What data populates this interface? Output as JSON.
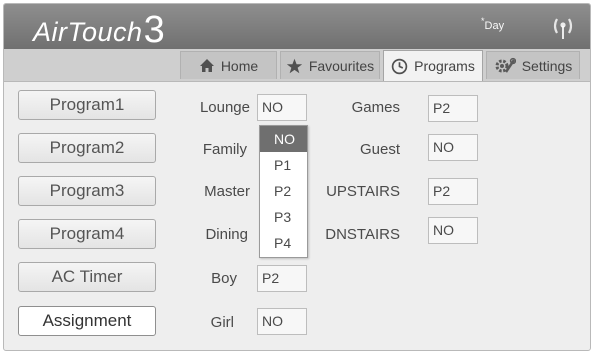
{
  "app": {
    "logo_text": "AirTouch",
    "logo_number": "3",
    "mode_star": "*",
    "mode_text": "Day"
  },
  "tabs": [
    {
      "label": "Home",
      "icon": "home-icon"
    },
    {
      "label": "Favourites",
      "icon": "star-icon"
    },
    {
      "label": "Programs",
      "icon": "clock-icon",
      "active": true
    },
    {
      "label": "Settings",
      "icon": "gear-icon"
    }
  ],
  "program_buttons": [
    "Program1",
    "Program2",
    "Program3",
    "Program4",
    "AC Timer",
    "Assignment"
  ],
  "selected_button": "Assignment",
  "zones_left": [
    {
      "label": "Lounge",
      "value": "NO"
    },
    {
      "label": "Family",
      "value": ""
    },
    {
      "label": "Master",
      "value": ""
    },
    {
      "label": "Dining",
      "value": ""
    },
    {
      "label": "Boy",
      "value": "P2"
    },
    {
      "label": "Girl",
      "value": "NO"
    }
  ],
  "zones_right": [
    {
      "label": "Games",
      "value": "P2"
    },
    {
      "label": "Guest",
      "value": "NO"
    },
    {
      "label": "UPSTAIRS",
      "value": "P2"
    },
    {
      "label": "DNSTAIRS",
      "value": "NO"
    }
  ],
  "dropdown": {
    "options": [
      "NO",
      "P1",
      "P2",
      "P3",
      "P4"
    ],
    "highlighted": "NO"
  },
  "colors": {
    "topbar": "#7a7a7a",
    "tabbar": "#cfcfcf",
    "active_tab": "#f2f2f2",
    "highlight": "#6f6f6f"
  }
}
